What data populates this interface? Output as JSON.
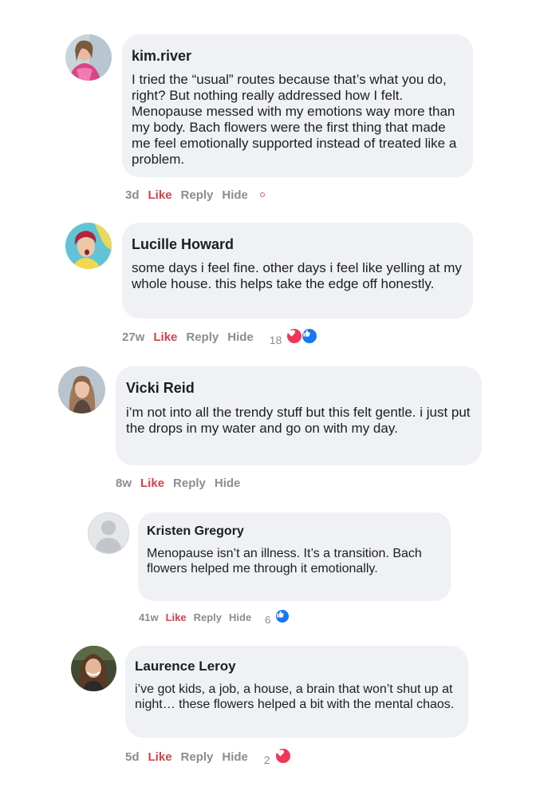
{
  "comments": [
    {
      "author": "kim.river",
      "text": "I tried the “usual” routes because that’s what you do, right? But nothing really addressed how I felt. Menopause messed with my emotions way more than my body. Bach flowers were the first thing that made me feel emotionally supported instead of treated like a problem.",
      "time": "3d",
      "like": "Like",
      "reply": "Reply",
      "hide": "Hide"
    },
    {
      "author": "Lucille Howard",
      "text": "some days i feel fine. other days i feel like yelling at my whole house. this helps take the edge off honestly.",
      "time": "27w",
      "like": "Like",
      "reply": "Reply",
      "hide": "Hide",
      "reaction_count": "18",
      "reactions": [
        "heart-icon",
        "like-icon"
      ]
    },
    {
      "author": "Vicki Reid",
      "text": "i’m not into all the trendy stuff but this felt gentle. i just put the drops in my water and go on with my day.",
      "time": "8w",
      "like": "Like",
      "reply": "Reply",
      "hide": "Hide"
    },
    {
      "author": "Kristen Gregory",
      "text": "Menopause isn’t an illness. It’s a transition. Bach flowers helped me through it emotionally.",
      "time": "41w",
      "like": "Like",
      "reply": "Reply",
      "hide": "Hide",
      "reaction_count": "6",
      "reactions": [
        "like-icon"
      ]
    },
    {
      "author": "Laurence Leroy",
      "text": "i’ve got kids, a job, a house, a brain that won’t shut up at night… these flowers helped a bit with the mental chaos.",
      "time": "5d",
      "like": "Like",
      "reply": "Reply",
      "hide": "Hide",
      "reaction_count": "2",
      "reactions": [
        "heart-icon"
      ]
    }
  ],
  "colors": {
    "bubble": "#f0f1f4",
    "like_active": "#d9404b",
    "meta": "#8a8d91",
    "heart": "#f0365a",
    "thumb": "#1877f2"
  }
}
